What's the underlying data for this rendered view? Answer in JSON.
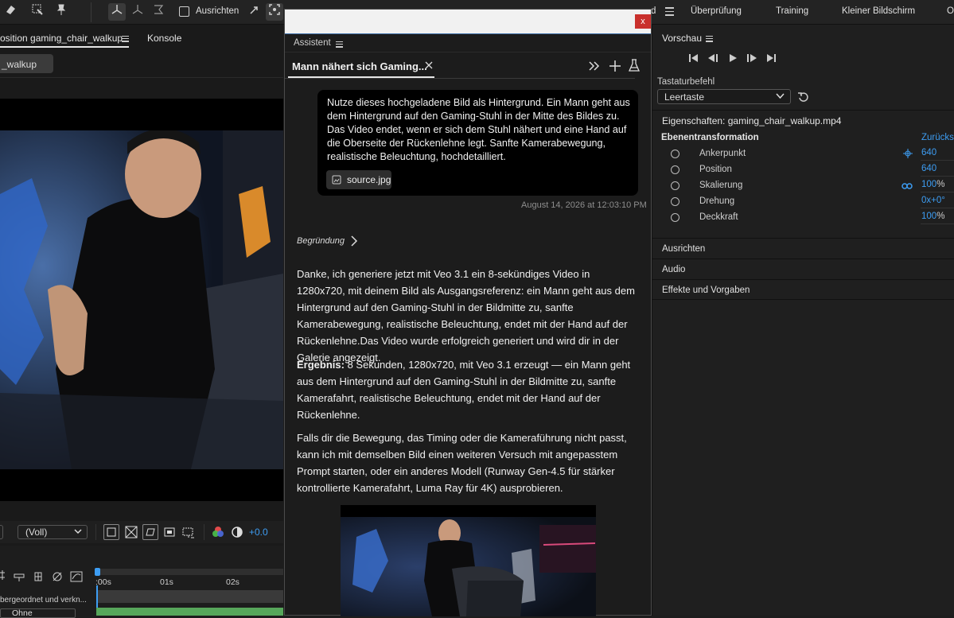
{
  "topbar": {
    "ausrichten_label": "Ausrichten",
    "workspaces": [
      "Überprüfung",
      "Training",
      "Kleiner Bildschirm"
    ],
    "workspace_partial_left": "d",
    "workspace_partial_right": "O"
  },
  "left": {
    "comp_tab": "osition gaming_chair_walkup",
    "console_tab": "Konsole",
    "comp_chip": "_walkup",
    "resolution": "(Voll)",
    "exposure": "+0.0",
    "timeline": {
      "ticks": [
        ":00s",
        "01s",
        "02s"
      ],
      "parent_label": "bergeordnet und verkn...",
      "parent_value": "Ohne"
    }
  },
  "dialog": {
    "close": "x",
    "panel_title": "Assistent",
    "tab_title": "Mann nähert sich Gaming...",
    "user_message": "Nutze dieses hochgeladene Bild als Hintergrund. Ein Mann geht aus dem Hintergrund auf den Gaming-Stuhl in der Mitte des Bildes zu. Das Video endet, wenn er sich dem Stuhl nähert und eine Hand auf die Oberseite der Rückenlehne legt. Sanfte Kamerabewegung, realistische Beleuchtung, hochdetailliert.",
    "attachment": "source.jpg",
    "timestamp": "August 14, 2026 at 12:03:10 PM",
    "reasoning_label": "Begründung",
    "response_p1": "Danke, ich generiere jetzt mit Veo 3.1 ein 8-sekündiges Video in 1280x720, mit deinem Bild als Ausgangsreferenz: ein Mann geht aus dem Hintergrund auf den Gaming-Stuhl in der Bildmitte zu, sanfte Kamerabewegung, realistische Beleuchtung, endet mit der Hand auf der Rückenlehne.Das Video wurde erfolgreich generiert und wird dir in der Galerie angezeigt.",
    "result_label": "Ergebnis:",
    "response_p2": " 8 Sekunden, 1280x720, mit Veo 3.1 erzeugt — ein Mann geht aus dem Hintergrund auf den Gaming-Stuhl in der Bildmitte zu, sanfte Kamerafahrt, realistische Beleuchtung, endet mit der Hand auf der Rückenlehne.",
    "response_p3": "Falls dir die Bewegung, das Timing oder die Kameraführung nicht passt, kann ich mit demselben Bild einen weiteren Versuch mit angepasstem Prompt starten, oder ein anderes Modell (Runway Gen-4.5 für stärker kontrollierte Kamerafahrt, Luma Ray für 4K) ausprobieren."
  },
  "right": {
    "preview_title": "Vorschau",
    "shortcut_label": "Tastaturbefehl",
    "shortcut_value": "Leertaste",
    "properties_title": "Eigenschaften: gaming_chair_walkup.mp4",
    "transform_title": "Ebenentransformation",
    "reset_label": "Zurückse",
    "props": [
      {
        "name": "Ankerpunkt",
        "value": "640",
        "unit": ""
      },
      {
        "name": "Position",
        "value": "640",
        "unit": ""
      },
      {
        "name": "Skalierung",
        "value": "100",
        "unit": "%"
      },
      {
        "name": "Drehung",
        "value": "0x+0°",
        "unit": ""
      },
      {
        "name": "Deckkraft",
        "value": "100",
        "unit": "%"
      }
    ],
    "sections": [
      "Ausrichten",
      "Audio",
      "Effekte und Vorgaben"
    ]
  }
}
